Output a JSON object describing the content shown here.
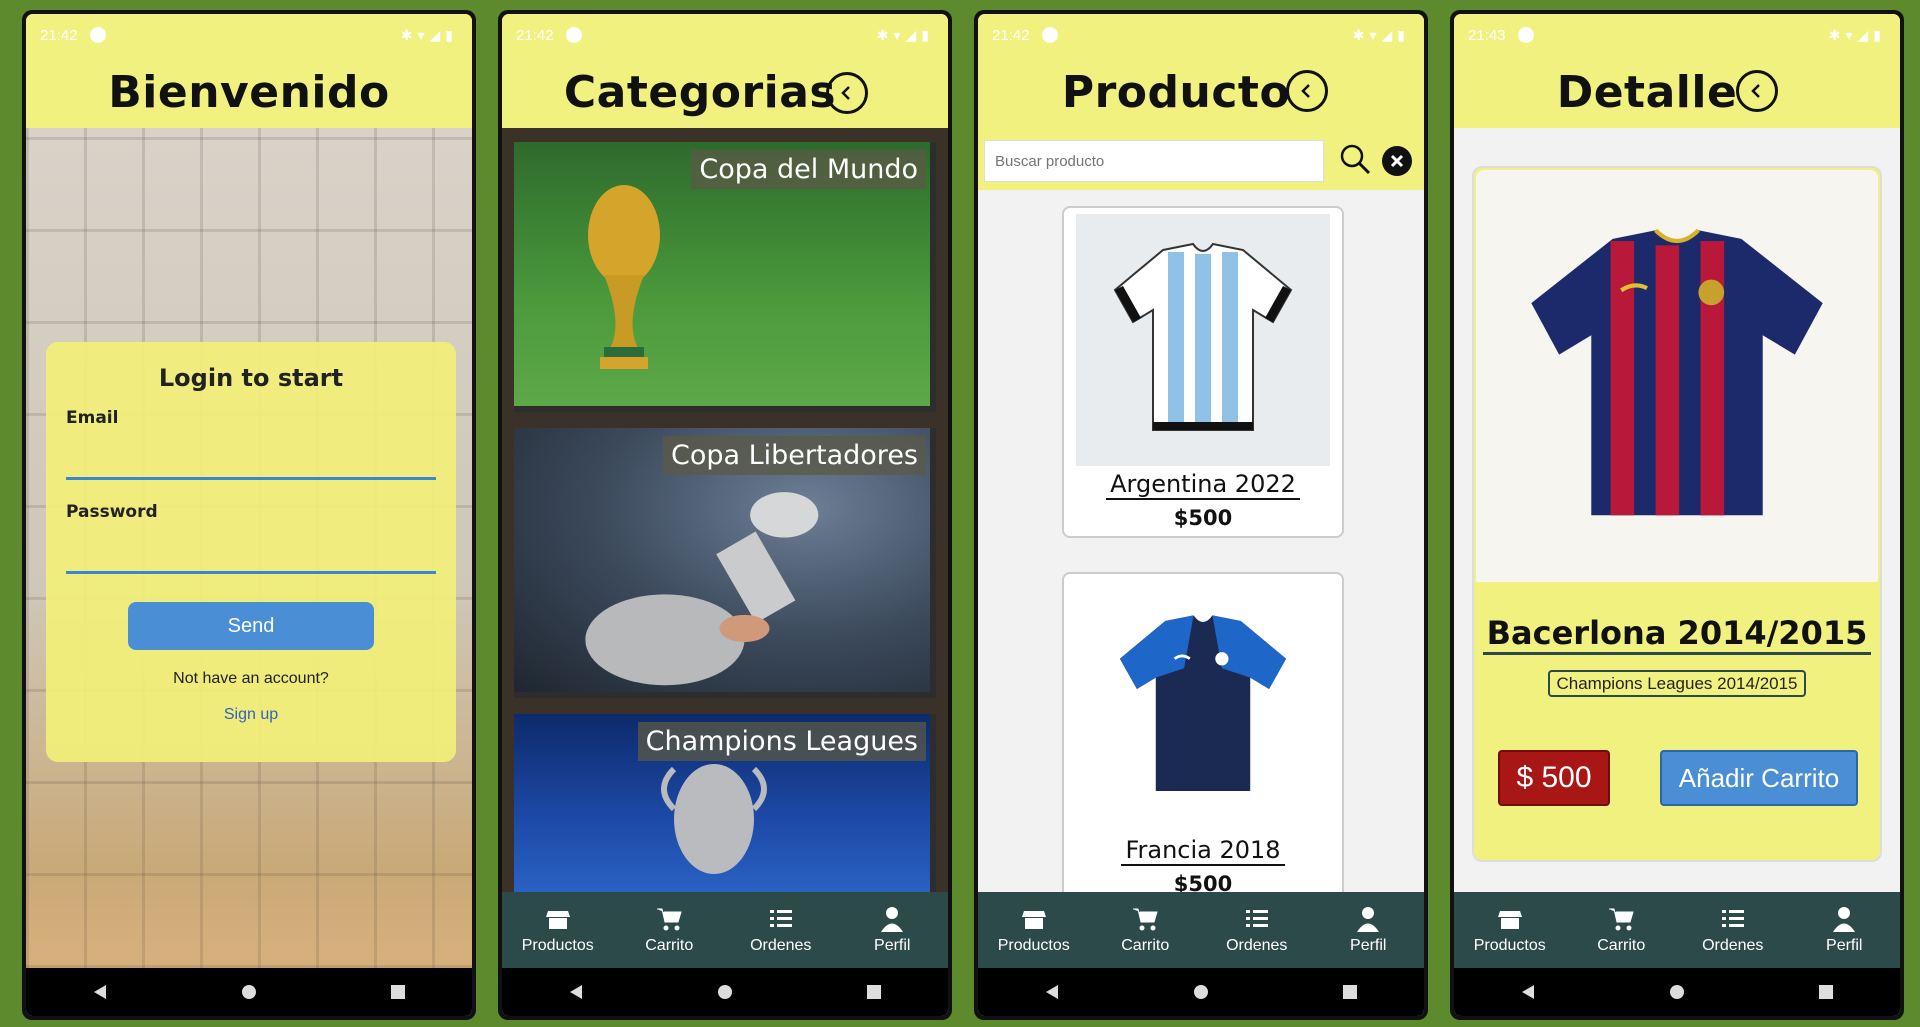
{
  "tabs": [
    {
      "label": "Productos",
      "icon": "store-icon"
    },
    {
      "label": "Carrito",
      "icon": "cart-icon"
    },
    {
      "label": "Ordenes",
      "icon": "list-icon"
    },
    {
      "label": "Perfil",
      "icon": "user-icon"
    }
  ],
  "screens": {
    "welcome": {
      "time": "21:42",
      "title": "Bienvenido",
      "login": {
        "heading": "Login to start",
        "email_label": "Email",
        "password_label": "Password",
        "send_label": "Send",
        "no_account": "Not have an account?",
        "signup": "Sign up"
      }
    },
    "categories": {
      "time": "21:42",
      "title": "Categorias",
      "items": [
        {
          "label": "Copa del Mundo"
        },
        {
          "label": "Copa Libertadores"
        },
        {
          "label": "Champions Leagues"
        }
      ]
    },
    "products": {
      "time": "21:42",
      "title": "Producto",
      "search_placeholder": "Buscar producto",
      "items": [
        {
          "name": "Argentina 2022",
          "price": "$500"
        },
        {
          "name": "Francia 2018",
          "price": "$500"
        }
      ]
    },
    "detail": {
      "time": "21:43",
      "title": "Detalle",
      "name": "Bacerlona 2014/2015",
      "category": "Champions Leagues 2014/2015",
      "price": "$ 500",
      "add_cart": "Añadir Carrito"
    }
  },
  "colors": {
    "background": "#5d8a2c",
    "header": "#f1f17f",
    "tabbar": "#2c4a4a",
    "accent_blue": "#4a8fd6",
    "price_red": "#a81616"
  }
}
